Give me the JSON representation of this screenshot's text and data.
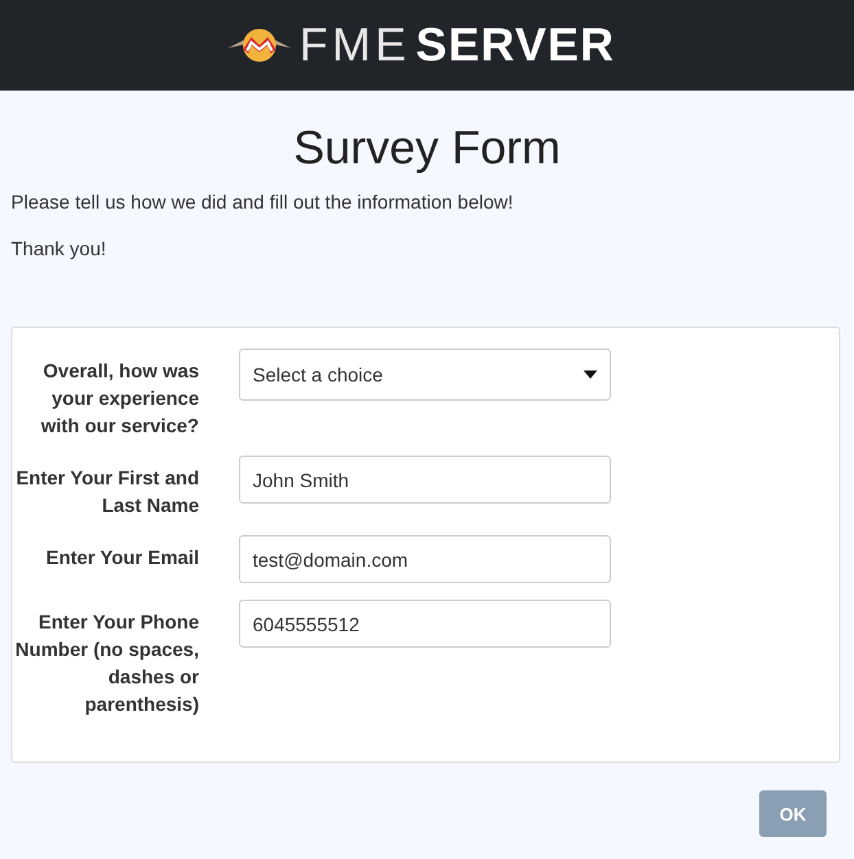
{
  "header": {
    "logo_light": "FME",
    "logo_bold": "SERVER"
  },
  "title": "Survey Form",
  "intro": [
    "Please tell us how we did and fill out the information below!",
    "Thank you!"
  ],
  "fields": [
    {
      "kind": "select",
      "label": "Overall, how was your experience with our service?",
      "placeholder": "Select a choice"
    },
    {
      "kind": "text",
      "label": "Enter Your First and Last Name",
      "value": "John Smith"
    },
    {
      "kind": "text",
      "label": "Enter Your Email",
      "value": "test@domain.com"
    },
    {
      "kind": "text",
      "label": "Enter Your Phone Number (no spaces, dashes or parenthesis)",
      "value": "6045555512"
    }
  ],
  "buttons": [
    "OK"
  ]
}
